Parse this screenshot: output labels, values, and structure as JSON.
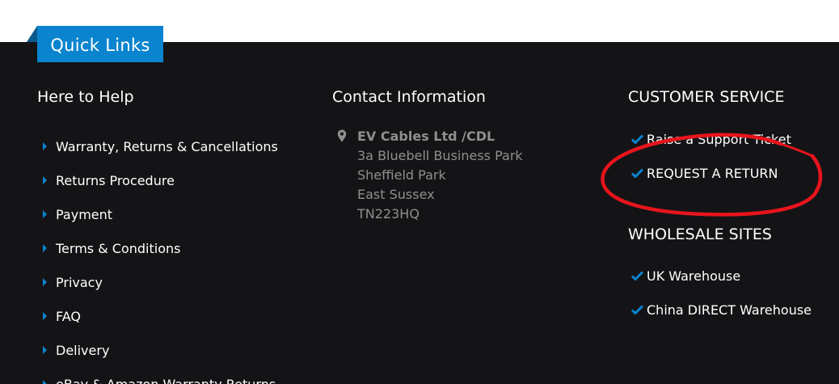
{
  "quick_links": {
    "label": "Quick Links"
  },
  "here_to_help": {
    "heading": "Here to Help",
    "items": [
      {
        "label": "Warranty, Returns & Cancellations"
      },
      {
        "label": "Returns Procedure"
      },
      {
        "label": "Payment"
      },
      {
        "label": "Terms & Conditions"
      },
      {
        "label": "Privacy"
      },
      {
        "label": "FAQ"
      },
      {
        "label": "Delivery"
      },
      {
        "label": "eBay & Amazon Warranty Returns"
      }
    ]
  },
  "contact": {
    "heading": "Contact Information",
    "icon": "map-pin-icon",
    "company": "EV Cables Ltd /CDL",
    "address_lines": [
      "3a Bluebell Business Park",
      "Sheffield Park",
      "East Sussex",
      "TN223HQ"
    ]
  },
  "customer_service": {
    "heading": "CUSTOMER SERVICE",
    "items": [
      {
        "label": "Raise a Support Ticket"
      },
      {
        "label": "REQUEST A RETURN"
      }
    ]
  },
  "wholesale": {
    "heading": "WHOLESALE SITES",
    "items": [
      {
        "label": "UK Warehouse"
      },
      {
        "label": "China DIRECT Warehouse"
      }
    ]
  },
  "colors": {
    "footer_bg": "#141417",
    "accent_blue": "#0a84cf",
    "annotation_red": "#e8141c",
    "muted_text": "#8f8f8f"
  }
}
